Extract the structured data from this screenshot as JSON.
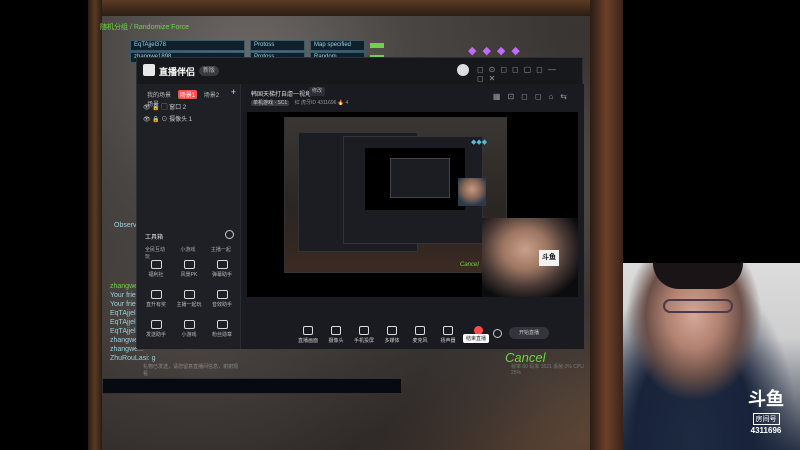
{
  "game": {
    "options_header": "随机分组 / Randomize Force",
    "rows": [
      {
        "name": "EqTAjjel378",
        "race": "Protoss",
        "map": "Map specified"
      },
      {
        "name": "zhangwe1898",
        "race": "Protoss",
        "map": "Random"
      }
    ],
    "observer_label": "Observ",
    "chat_lines": [
      {
        "text": "zhangwe...",
        "color": "green"
      },
      {
        "text": "Your frie...",
        "color": "blue"
      },
      {
        "text": "Your frie...",
        "color": "blue"
      },
      {
        "text": "EqTAjjel...",
        "color": "blue"
      },
      {
        "text": "EqTAjjel...",
        "color": "blue"
      },
      {
        "text": "EqTAjjel...",
        "color": "blue"
      },
      {
        "text": "zhangwe...",
        "color": "blue"
      },
      {
        "text": "zhangwe...",
        "color": "blue"
      },
      {
        "text": "ZhuRouLasi: g",
        "color": "blue"
      }
    ],
    "cancel_label": "Cancel"
  },
  "app": {
    "name": "直播伴侣",
    "version_badge": "新版",
    "tabs": [
      "我的场景",
      "场景1",
      "场景2",
      "场景"
    ],
    "active_tab_index": 1,
    "sources": [
      {
        "label": "窗口 2"
      },
      {
        "label": "摄像头 1"
      }
    ],
    "toolbox_title": "工具箱",
    "tool_links": [
      "全民互动",
      "小游戏",
      "主播一起玩"
    ],
    "tools": [
      {
        "label": "福利社"
      },
      {
        "label": "风景PK"
      },
      {
        "label": "弹幕助手"
      },
      {
        "label": "直升有奖"
      },
      {
        "label": "主播一起玩"
      },
      {
        "label": "音效助手"
      },
      {
        "label": "发送助手"
      },
      {
        "label": "小游戏"
      },
      {
        "label": "粉丝勋章"
      }
    ],
    "live_title": "韩国天梯打自虐一视角",
    "live_edit": "修改",
    "live_meta_badge": "单机游戏 · SC1",
    "live_meta_text": "红 虎牙ID 4311696  🔥 4",
    "controls": [
      {
        "label": "直播画面"
      },
      {
        "label": "摄像头"
      },
      {
        "label": "手机投屏"
      },
      {
        "label": "多媒体"
      },
      {
        "label": "麦克风"
      },
      {
        "label": "扬声器"
      },
      {
        "label": "结束直播"
      }
    ],
    "tooltip": "结束直播",
    "start_button": "开始直播",
    "bottom_status": "礼物已发送，请您留意直播间信息，谢谢观看",
    "bottom_stats": "帧率 60  码率 3521  丢帧 0%  CPU 25%"
  },
  "preview": {
    "nested_cancel": "Cancel",
    "logo_text": "斗鱼"
  },
  "webcam_overlay": {
    "brand_mark": "斗鱼",
    "brand_label": "房间号",
    "room_id": "4311696"
  }
}
